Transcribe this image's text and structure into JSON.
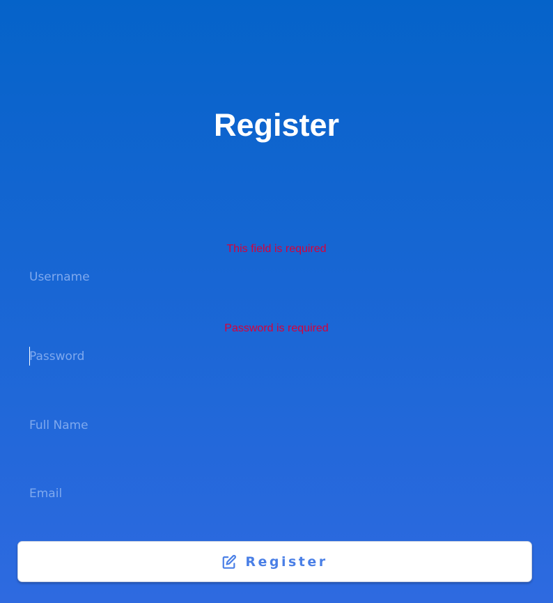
{
  "title": "Register",
  "form": {
    "username": {
      "placeholder": "Username",
      "value": "",
      "error": "This field is required"
    },
    "password": {
      "placeholder": "Password",
      "value": "",
      "error": "Password is required"
    },
    "full_name": {
      "placeholder": "Full Name",
      "value": ""
    },
    "email": {
      "placeholder": "Email",
      "value": ""
    },
    "submit": {
      "label": "Register",
      "icon": "edit-icon"
    }
  },
  "colors": {
    "background_top": "#0563c9",
    "background_bottom": "#2e6ae0",
    "error": "#d8003a",
    "button_text": "#4a7fe6",
    "placeholder": "#7fa9ee"
  }
}
